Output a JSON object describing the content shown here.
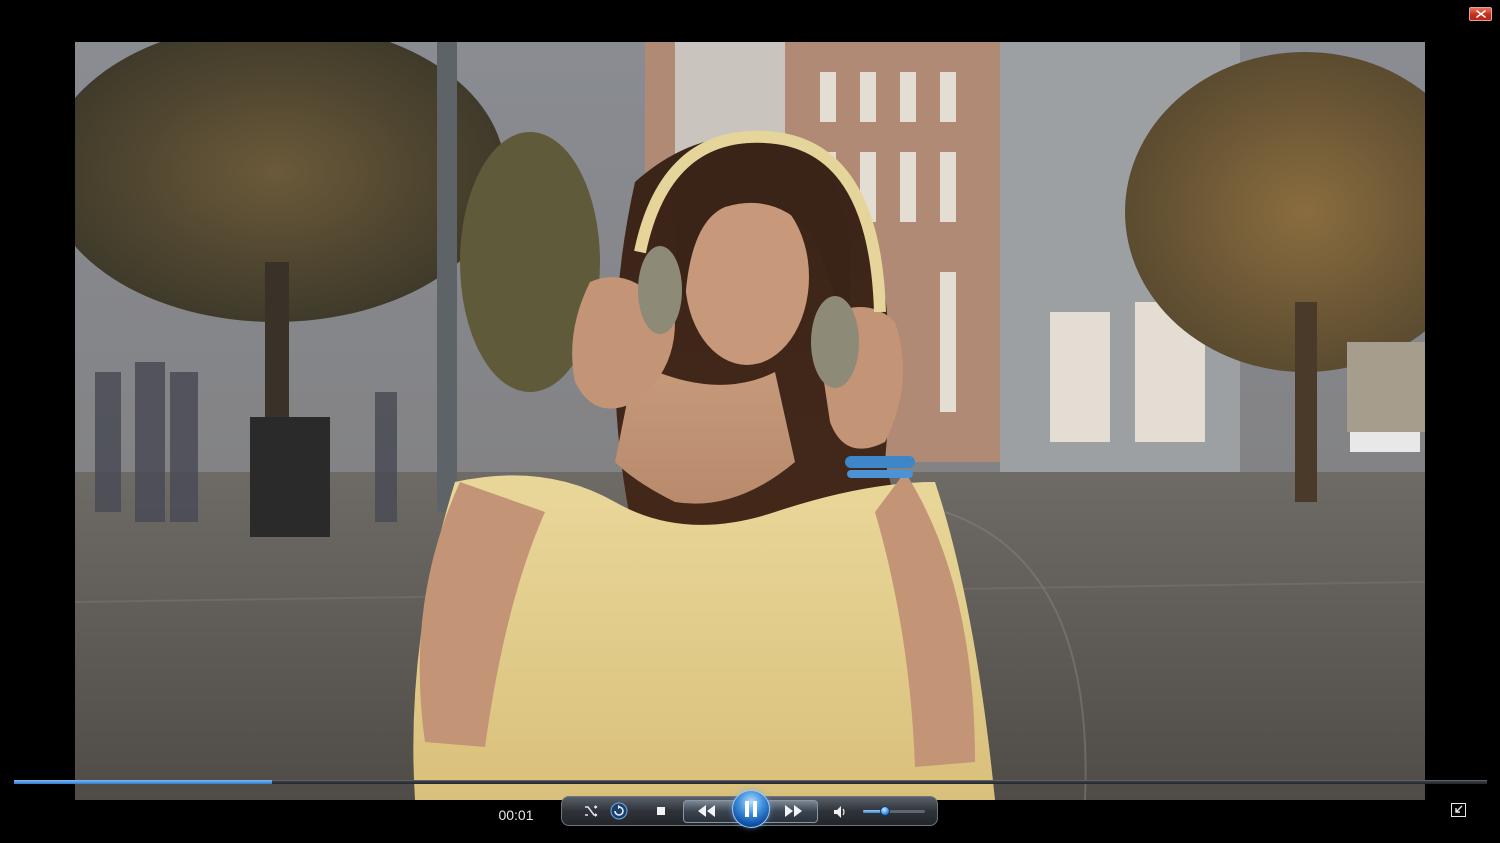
{
  "player": {
    "current_time": "00:01",
    "progress": 0.175,
    "volume": 0.35,
    "state": "playing"
  },
  "controls": {
    "close_icon": "close-icon",
    "shuffle_icon": "shuffle-icon",
    "repeat_icon": "repeat-icon",
    "stop_icon": "stop-icon",
    "rewind_icon": "rewind-icon",
    "pause_icon": "pause-icon",
    "forward_icon": "fast-forward-icon",
    "mute_icon": "speaker-icon",
    "switch_icon": "switch-to-library-icon"
  },
  "colors": {
    "accent": "#3e8fdc",
    "close": "#c4301a",
    "background": "#000000"
  }
}
